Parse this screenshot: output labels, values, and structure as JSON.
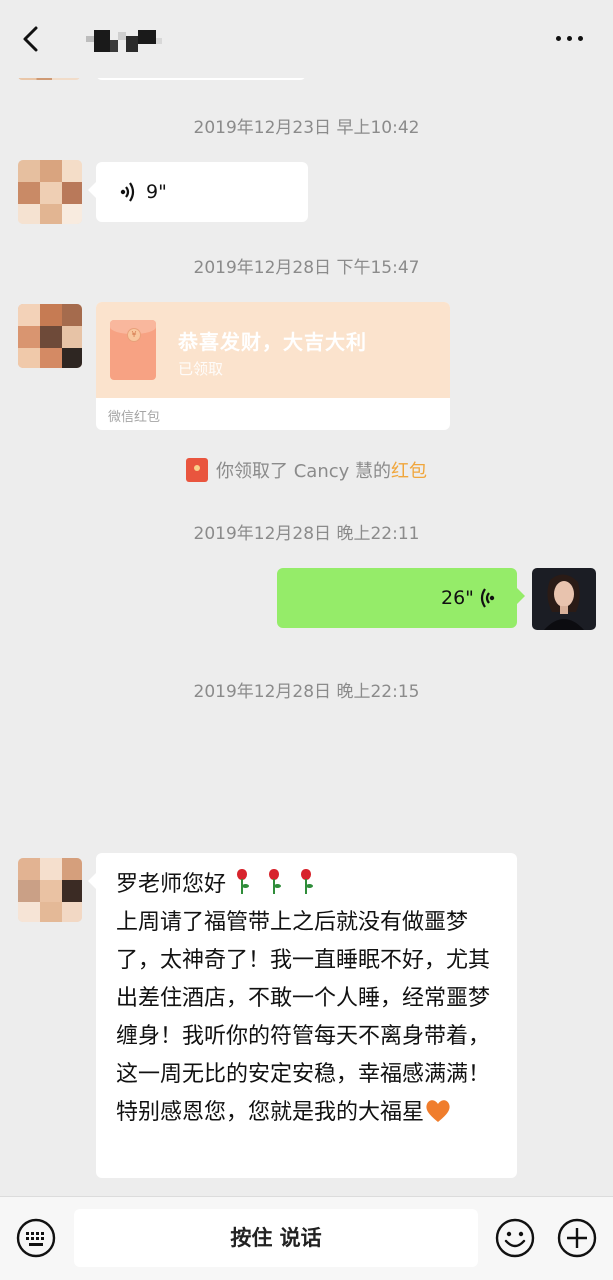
{
  "header": {
    "back_icon": "chevron-left-icon",
    "more_icon": "more-dots-icon"
  },
  "timestamps": {
    "t1": "2019年12月23日 早上10:42",
    "t2": "2019年12月28日 下午15:47",
    "t3": "2019年12月28日 晚上22:11",
    "t4": "2019年12月28日 晚上22:15"
  },
  "messages": {
    "voice_in": {
      "duration": "9\""
    },
    "red_packet": {
      "title": "恭喜发财，大吉大利",
      "status": "已领取",
      "footer": "微信红包"
    },
    "system_notice": {
      "prefix": "你领取了 Cancy 慧的",
      "highlight": "红包"
    },
    "voice_out": {
      "duration": "26\""
    },
    "long_text": {
      "greeting": "罗老师您好",
      "body": "上周请了福管带上之后就没有做噩梦了，太神奇了！我一直睡眠不好，尤其出差住酒店，不敢一个人睡，经常噩梦缠身！我听你的符管每天不离身带着，这一周无比的安定安稳，幸福感满满！特别感恩您，您就是我的大福星"
    }
  },
  "input_bar": {
    "hold_to_talk": "按住 说话",
    "keyboard_icon": "keyboard-icon",
    "emoji_icon": "emoji-icon",
    "plus_icon": "plus-icon"
  },
  "colors": {
    "background": "#ededed",
    "outgoing_bubble": "#95ec69",
    "red_packet_bg": "#fbe3cd",
    "highlight": "#f0a63c"
  }
}
